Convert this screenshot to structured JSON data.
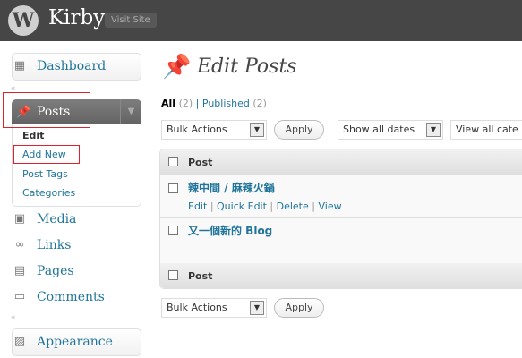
{
  "header": {
    "logo_glyph": "W",
    "site_title": "Kirby",
    "visit_site": "Visit Site"
  },
  "sidebar": {
    "dashboard": "Dashboard",
    "posts": "Posts",
    "posts_sub": [
      "Edit",
      "Add New",
      "Post Tags",
      "Categories"
    ],
    "media": "Media",
    "links": "Links",
    "pages": "Pages",
    "comments": "Comments",
    "appearance": "Appearance",
    "icons": {
      "dashboard": "dashboard-icon",
      "posts": "pushpin-icon",
      "media": "media-icon",
      "links": "links-icon",
      "pages": "pages-icon",
      "comments": "comments-icon",
      "appearance": "appearance-icon"
    }
  },
  "main": {
    "title": "Edit Posts",
    "filters": {
      "all": "All",
      "all_count": "(2)",
      "sep": "|",
      "published": "Published",
      "published_count": "(2)"
    },
    "bulk_actions": "Bulk Actions",
    "apply": "Apply",
    "dates": "Show all dates",
    "categories": "View all cate",
    "col_post": "Post",
    "posts": [
      {
        "title": "辣中間 / 麻辣火鍋",
        "actions": [
          "Edit",
          "Quick Edit",
          "Delete",
          "View"
        ]
      },
      {
        "title": "又一個新的 Blog"
      }
    ]
  },
  "colors": {
    "header_bg": "#464646",
    "link": "#21759b",
    "highlight_box": "#e0202a"
  }
}
